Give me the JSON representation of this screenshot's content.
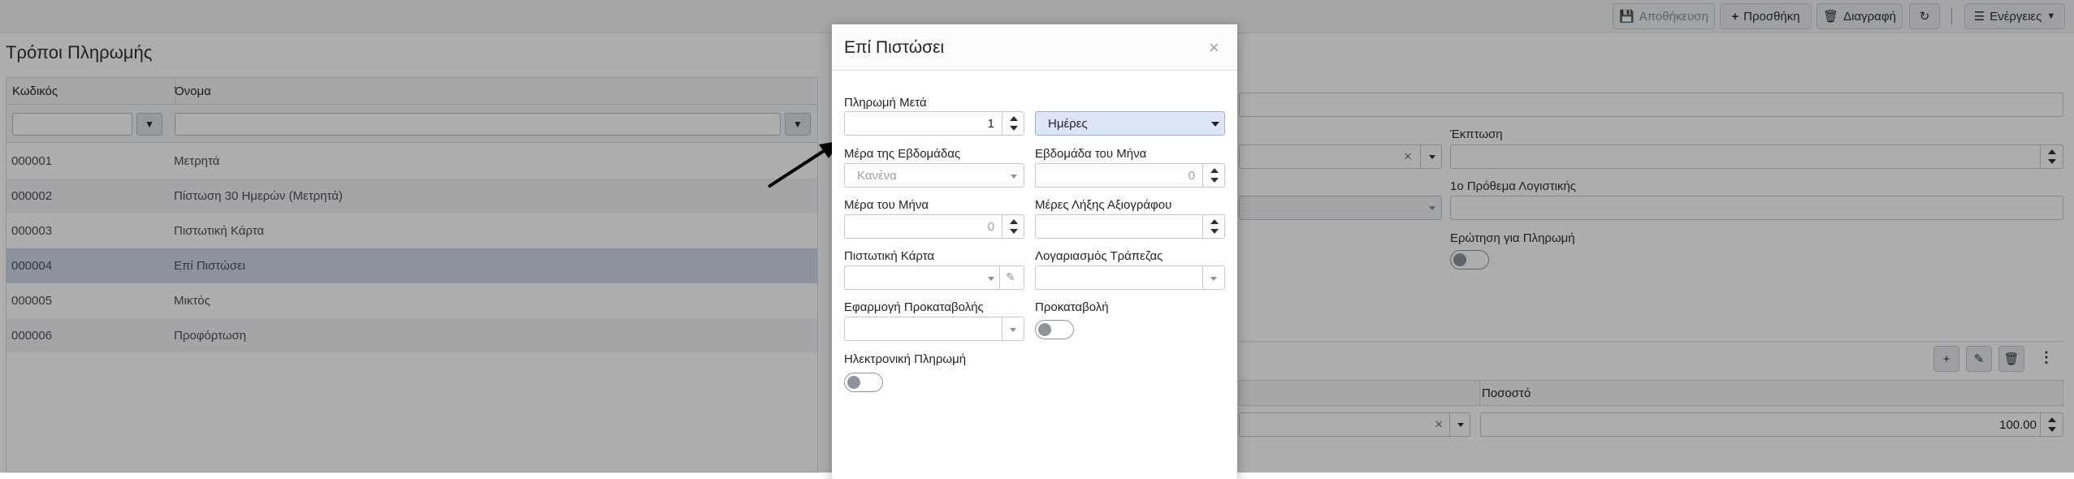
{
  "toolbar": {
    "save_label": "Αποθήκευση",
    "add_label": "Προσθήκη",
    "delete_label": "Διαγραφή",
    "actions_label": "Ενέργειες"
  },
  "page": {
    "title": "Τρόποι Πληρωμής",
    "columns": [
      "Κωδικός",
      "Όνομα"
    ],
    "rows": [
      {
        "code": "000001",
        "name": "Μετρητά"
      },
      {
        "code": "000002",
        "name": "Πίστωση 30 Ημερών (Μετρητά)"
      },
      {
        "code": "000003",
        "name": "Πιστωτική Κάρτα"
      },
      {
        "code": "000004",
        "name": "Επί Πιστώσει"
      },
      {
        "code": "000005",
        "name": "Μικτός"
      },
      {
        "code": "000006",
        "name": "Προφόρτωση"
      }
    ]
  },
  "detail": {
    "discount_label": "Έκπτωση",
    "accounting_prefix_label": "1ο Πρόθεμα Λογιστικής",
    "ask_payment_label": "Ερώτηση για Πληρωμή",
    "percent_header": "Ποσοστό",
    "percent_value": "100.00"
  },
  "modal": {
    "title": "Επί Πιστώσει",
    "close_glyph": "×",
    "pay_after_label": "Πληρωμή Μετά",
    "pay_after_value": "1",
    "unit_value": "Ημέρες",
    "weekday_label": "Μέρα της Εβδομάδας",
    "weekday_value": "Κανένα",
    "week_of_month_label": "Εβδομάδα του Μήνα",
    "week_of_month_value": "0",
    "day_of_month_label": "Μέρα του Μήνα",
    "day_of_month_value": "0",
    "cheque_days_label": "Μέρες Λήξης Αξιογράφου",
    "credit_card_label": "Πιστωτική Κάρτα",
    "bank_account_label": "Λογαριασμός Τράπεζας",
    "advance_apply_label": "Εφαρμογή Προκαταβολής",
    "advance_label": "Προκαταβολή",
    "e_payment_label": "Ηλεκτρονική Πληρωμή"
  }
}
